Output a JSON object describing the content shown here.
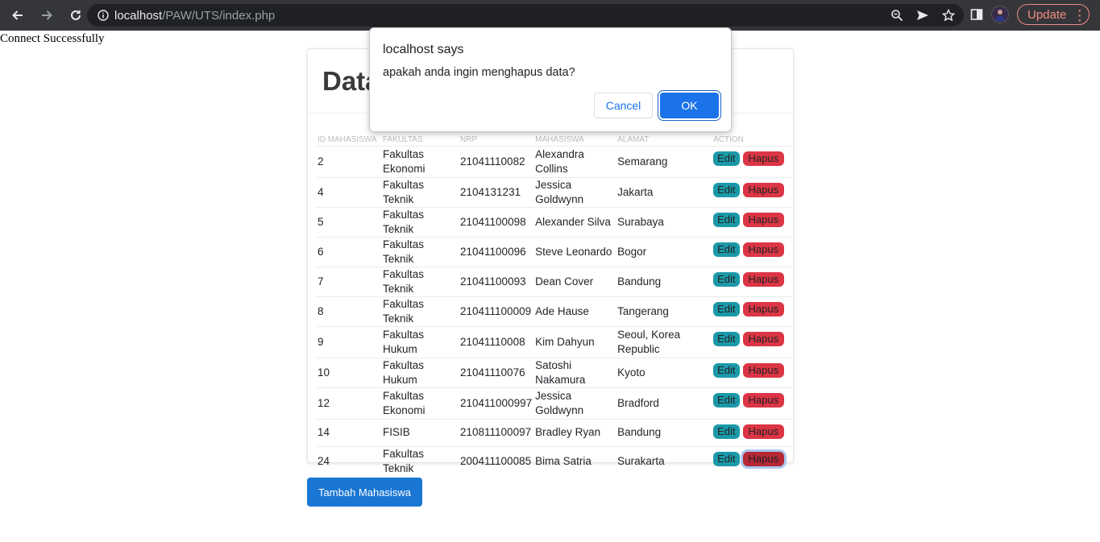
{
  "browser": {
    "url_host": "localhost",
    "url_path": "/PAW/UTS/index.php",
    "update_label": "Update"
  },
  "page": {
    "connect_message": "Connect Successfully",
    "card_title": "Data",
    "add_button": "Tambah Mahasiswa"
  },
  "table": {
    "headers": {
      "id": "ID MAHASISWA",
      "fakultas": "FAKULTAS",
      "nrp": "NRP",
      "nama": "MAHASISWA",
      "alamat": "ALAMAT",
      "action": "ACTION"
    },
    "edit_label": "Edit",
    "hapus_label": "Hapus",
    "rows": [
      {
        "id": "2",
        "fakultas": "Fakultas Ekonomi",
        "nrp": "21041110082",
        "nama": "Alexandra Collins",
        "alamat": "Semarang"
      },
      {
        "id": "4",
        "fakultas": "Fakultas Teknik",
        "nrp": "2104131231",
        "nama": "Jessica Goldwynn",
        "alamat": "Jakarta"
      },
      {
        "id": "5",
        "fakultas": "Fakultas Teknik",
        "nrp": "21041100098",
        "nama": "Alexander Silva",
        "alamat": "Surabaya"
      },
      {
        "id": "6",
        "fakultas": "Fakultas Teknik",
        "nrp": "21041100096",
        "nama": "Steve Leonardo",
        "alamat": "Bogor"
      },
      {
        "id": "7",
        "fakultas": "Fakultas Teknik",
        "nrp": "21041100093",
        "nama": "Dean Cover",
        "alamat": "Bandung"
      },
      {
        "id": "8",
        "fakultas": "Fakultas Teknik",
        "nrp": "210411100009",
        "nama": "Ade Hause",
        "alamat": "Tangerang"
      },
      {
        "id": "9",
        "fakultas": "Fakultas Hukum",
        "nrp": "21041110008",
        "nama": "Kim Dahyun",
        "alamat": "Seoul, Korea Republic"
      },
      {
        "id": "10",
        "fakultas": "Fakultas Hukum",
        "nrp": "21041110076",
        "nama": "Satoshi Nakamura",
        "alamat": "Kyoto"
      },
      {
        "id": "12",
        "fakultas": "Fakultas Ekonomi",
        "nrp": "210411000997",
        "nama": "Jessica Goldwynn",
        "alamat": "Bradford"
      },
      {
        "id": "14",
        "fakultas": "FISIB",
        "nrp": "210811100097",
        "nama": "Bradley Ryan",
        "alamat": "Bandung"
      },
      {
        "id": "24",
        "fakultas": "Fakultas Teknik",
        "nrp": "200411100085",
        "nama": "Bima Satria",
        "alamat": "Surakarta"
      }
    ]
  },
  "dialog": {
    "title": "localhost says",
    "message": "apakah anda ingin menghapus data?",
    "cancel_label": "Cancel",
    "ok_label": "OK"
  }
}
